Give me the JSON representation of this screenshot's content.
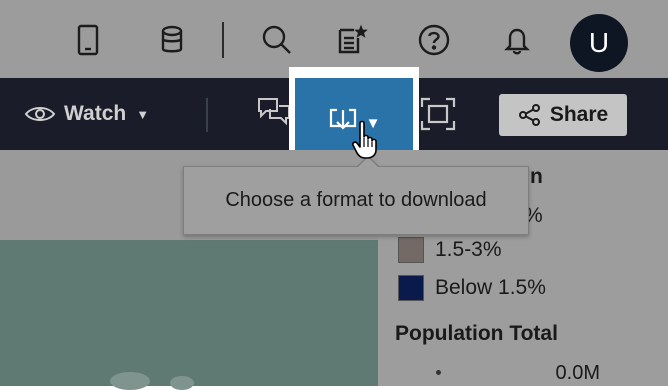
{
  "header": {
    "icons": [
      "tablet-icon",
      "database-icon",
      "search-icon",
      "favorites-icon",
      "help-icon",
      "bell-icon"
    ],
    "avatar_initial": "U"
  },
  "toolbar": {
    "watch_label": "Watch",
    "share_label": "Share",
    "download_tooltip": "Choose a format to download"
  },
  "legend": {
    "title_partial": "n",
    "partial_item": "%",
    "items": [
      {
        "label": "1.5-3%",
        "color": "#736a65"
      },
      {
        "label": "Below 1.5%",
        "color": "#0a1a4a"
      }
    ]
  },
  "population": {
    "title": "Population Total",
    "first_value": "0.0M"
  },
  "colors": {
    "header_bg": "#9c9c9c",
    "toolbar_bg": "#1a1d29",
    "download_active": "#2a73a8",
    "content_bg": "#9a9a9a",
    "map_fill": "#5e7a72"
  }
}
